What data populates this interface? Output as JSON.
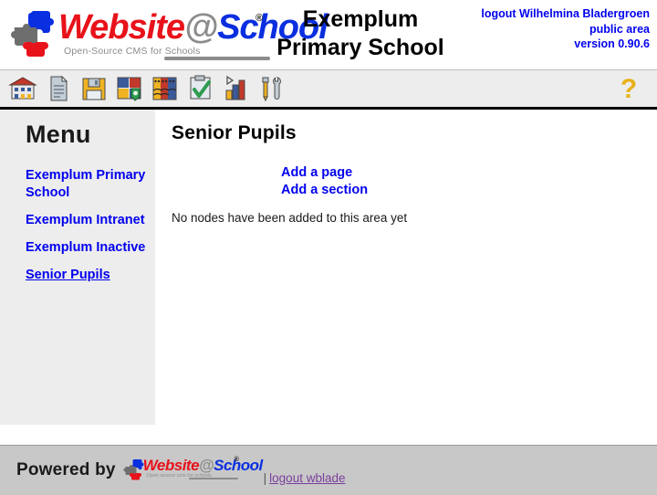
{
  "header": {
    "logo": {
      "word_website": "Website",
      "word_at": "@",
      "word_school": "School",
      "registered_mark": "®",
      "tagline": "Open-Source CMS for Schools"
    },
    "school_title_line1": "Exemplum",
    "school_title_line2": "Primary School",
    "user_logout": "logout Wilhelmina Bladergroen",
    "user_area": "public area",
    "version": "version 0.90.6",
    "link_color": "#0000ee"
  },
  "toolbar": {
    "items": [
      {
        "name": "school-icon",
        "title": "School"
      },
      {
        "name": "page-icon",
        "title": "Page"
      },
      {
        "name": "save-icon",
        "title": "Save"
      },
      {
        "name": "modules-icon",
        "title": "Modules"
      },
      {
        "name": "users-icon",
        "title": "Users"
      },
      {
        "name": "checklist-icon",
        "title": "Tasks"
      },
      {
        "name": "statistics-icon",
        "title": "Statistics"
      },
      {
        "name": "tools-icon",
        "title": "Tools"
      }
    ],
    "help_glyph": "?",
    "help_title": "Help",
    "background": "#ededed"
  },
  "sidebar": {
    "title": "Menu",
    "items": [
      {
        "label": "Exemplum Primary School",
        "current": false
      },
      {
        "label": "Exemplum Intranet",
        "current": false
      },
      {
        "label": "Exemplum Inactive",
        "current": false
      },
      {
        "label": "Senior Pupils",
        "current": true
      }
    ],
    "background": "#ededed"
  },
  "content": {
    "title": "Senior Pupils",
    "add_page_label": "Add a page",
    "add_section_label": "Add a section",
    "empty_message": "No nodes have been added to this area yet"
  },
  "footer": {
    "powered_by": "Powered by",
    "logo": {
      "word_website": "Website",
      "word_at": "@",
      "word_school": "School",
      "registered_mark": "®",
      "tagline": "Open source cms for schools"
    },
    "separator": "|",
    "logout_label": "logout wblade",
    "logout_color": "#7b3f9d",
    "background": "#c8c8c8"
  }
}
